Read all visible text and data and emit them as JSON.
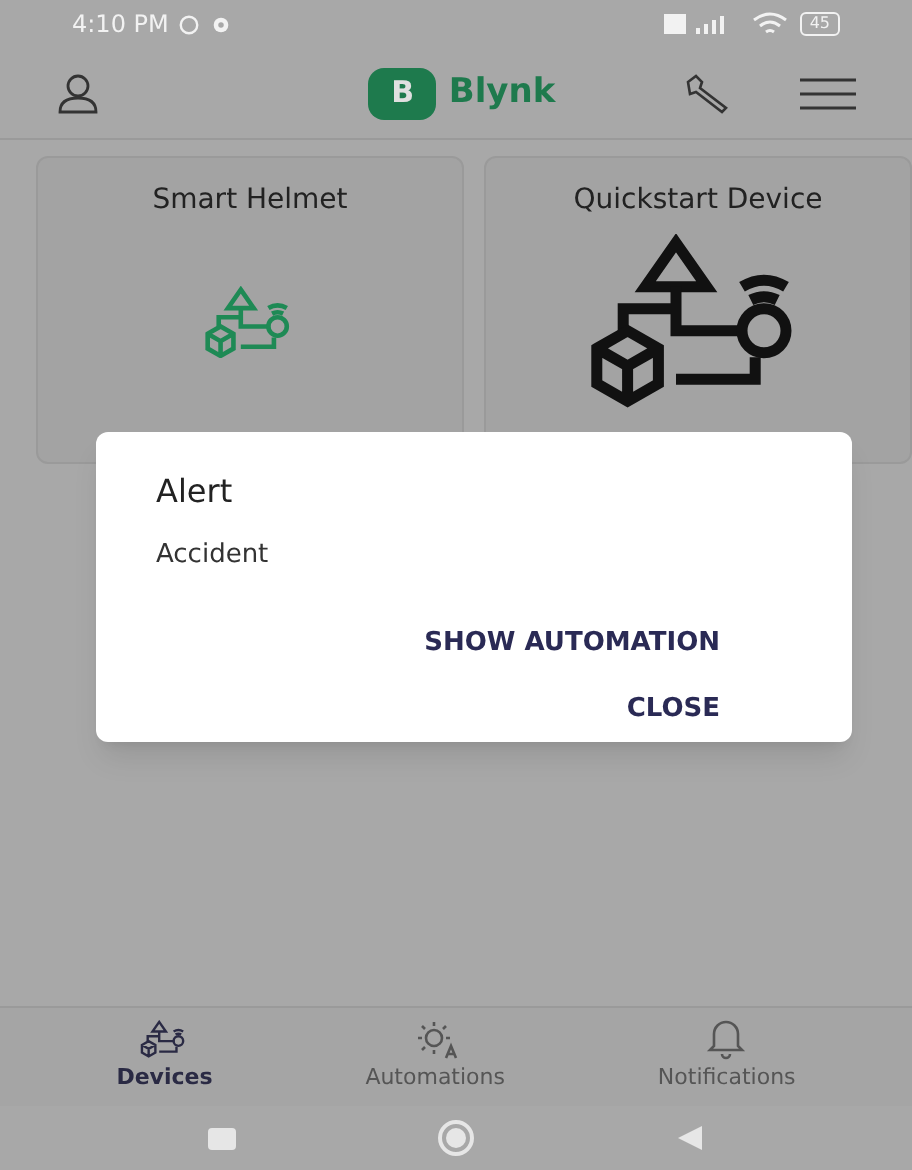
{
  "status_bar": {
    "time": "4:10 PM",
    "battery": "45"
  },
  "app_bar": {
    "logo_letter": "B",
    "title": "Blynk"
  },
  "devices": [
    {
      "name": "Smart Helmet",
      "kind": "small"
    },
    {
      "name": "Quickstart Device",
      "kind": "large"
    }
  ],
  "dialog": {
    "title": "Alert",
    "message": "Accident",
    "actions": [
      "SHOW AUTOMATION",
      "CLOSE"
    ]
  },
  "bottom_nav": [
    {
      "label": "Devices",
      "kind": "devices",
      "selected": true
    },
    {
      "label": "Automations",
      "kind": "automations",
      "selected": false
    },
    {
      "label": "Notifications",
      "kind": "notifications",
      "selected": false
    }
  ]
}
